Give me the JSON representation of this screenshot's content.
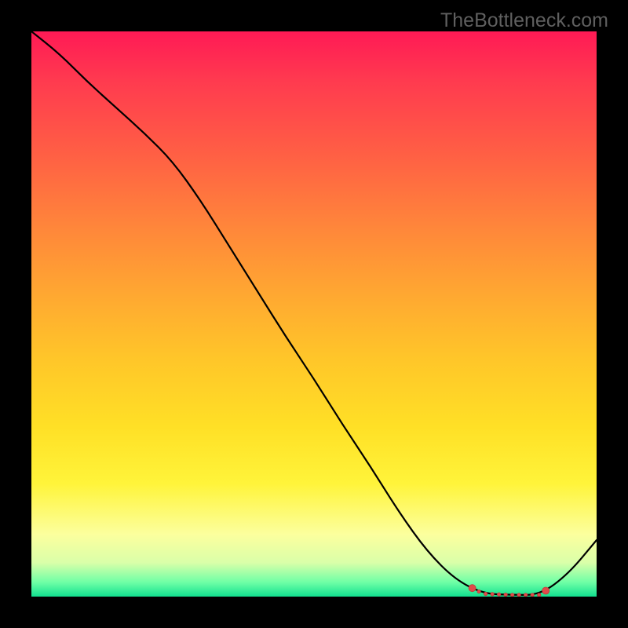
{
  "watermark": "TheBottleneck.com",
  "chart_data": {
    "type": "line",
    "title": "",
    "xlabel": "",
    "ylabel": "",
    "xlim": [
      0,
      100
    ],
    "ylim": [
      0,
      100
    ],
    "x": [
      0,
      5,
      10,
      15,
      20,
      25,
      30,
      35,
      40,
      45,
      50,
      55,
      60,
      65,
      70,
      75,
      80,
      85,
      90,
      95,
      100
    ],
    "values": [
      100,
      96,
      91,
      86.5,
      82,
      77,
      70,
      62,
      54,
      46,
      38.5,
      30.5,
      23,
      15,
      8,
      3,
      0.5,
      0.3,
      0.3,
      4,
      10
    ],
    "marker_region_x": [
      78,
      91
    ],
    "grid": false,
    "legend": false
  }
}
